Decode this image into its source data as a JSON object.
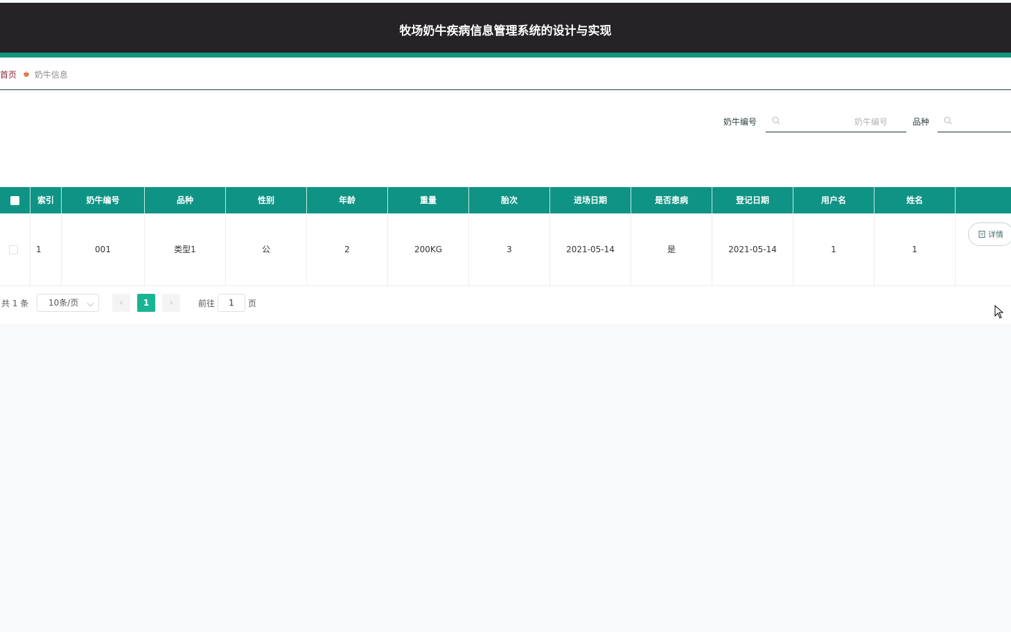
{
  "header": {
    "title": "牧场奶牛疾病信息管理系统的设计与实现"
  },
  "breadcrumb": {
    "home": "首页",
    "current": "奶牛信息"
  },
  "search": {
    "cow_number_label": "奶牛编号",
    "cow_number_placeholder": "奶牛编号",
    "breed_label": "品种",
    "breed_placeholder": ""
  },
  "table": {
    "headers": [
      "索引",
      "奶牛编号",
      "品种",
      "性别",
      "年龄",
      "重量",
      "胎次",
      "进场日期",
      "是否患病",
      "登记日期",
      "用户名",
      "姓名"
    ],
    "rows": [
      {
        "index": "1",
        "cow_number": "001",
        "breed": "类型1",
        "gender": "公",
        "age": "2",
        "weight": "200KG",
        "parity": "3",
        "entry_date": "2021-05-14",
        "sick": "是",
        "register_date": "2021-05-14",
        "username": "1",
        "name": "1",
        "action": "详情"
      }
    ]
  },
  "pagination": {
    "total": "共 1 条",
    "page_size": "10条/页",
    "prev": "‹",
    "current_page": "1",
    "next": "›",
    "goto_label": "前往",
    "goto_value": "1",
    "goto_unit": "页"
  },
  "colors": {
    "header_bg": "#252325",
    "accent": "#13967e",
    "table_header": "#0e9384",
    "page_active": "#19b494"
  }
}
